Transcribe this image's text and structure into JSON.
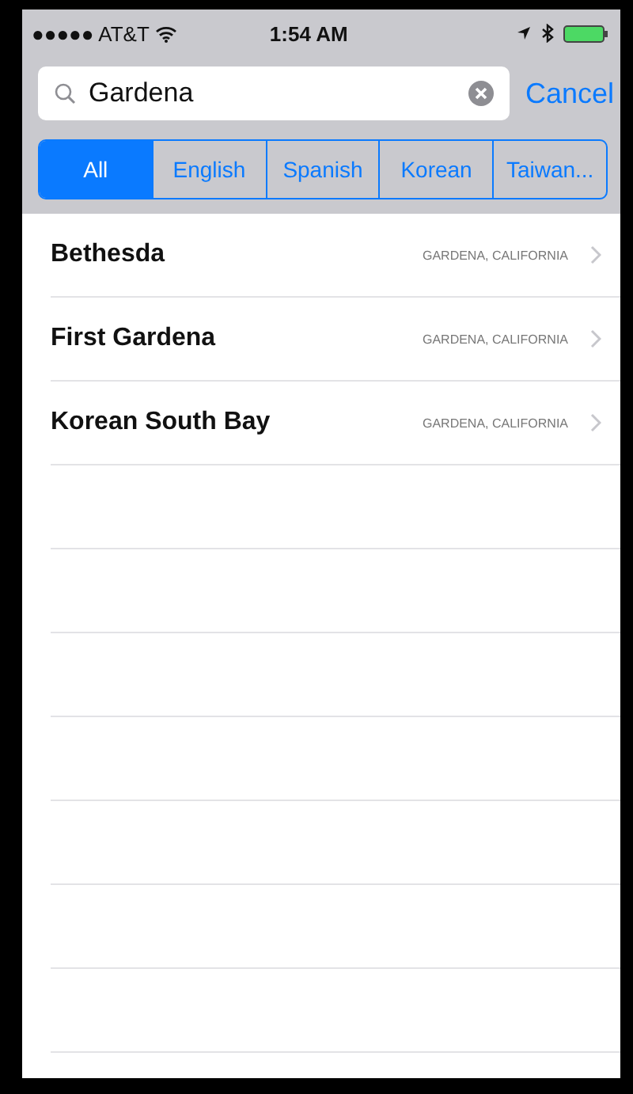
{
  "status_bar": {
    "carrier": "●●●●● AT&T",
    "time": "1:54 AM"
  },
  "search": {
    "value": "Gardena",
    "cancel": "Cancel"
  },
  "filters": [
    {
      "label": "All",
      "selected": true
    },
    {
      "label": "English",
      "selected": false
    },
    {
      "label": "Spanish",
      "selected": false
    },
    {
      "label": "Korean",
      "selected": false
    },
    {
      "label": "Taiwan...",
      "selected": false
    }
  ],
  "results": [
    {
      "name": "Bethesda",
      "location": "GARDENA, CALIFORNIA"
    },
    {
      "name": "First Gardena",
      "location": "GARDENA, CALIFORNIA"
    },
    {
      "name": "Korean South Bay",
      "location": "GARDENA, CALIFORNIA"
    }
  ]
}
